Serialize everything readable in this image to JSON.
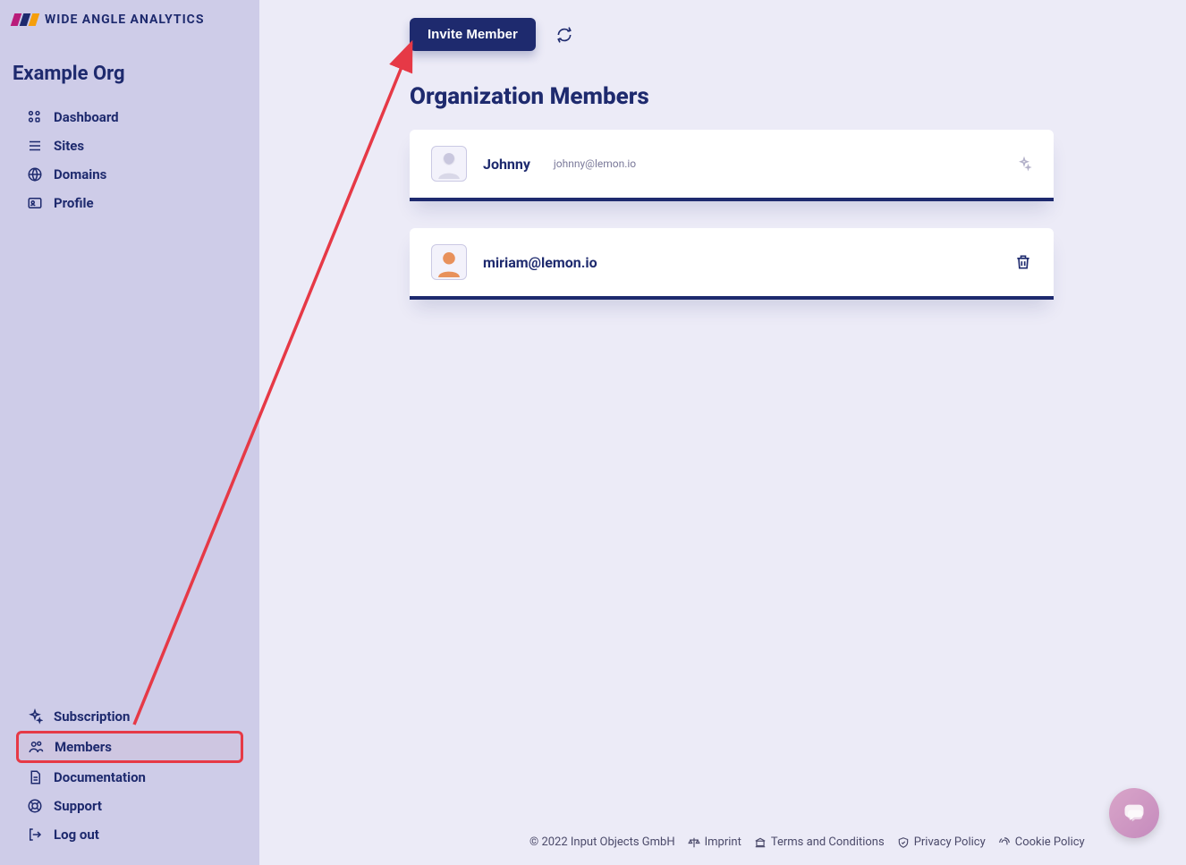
{
  "brand": {
    "name": "WIDE ANGLE ANALYTICS"
  },
  "org": {
    "name": "Example Org"
  },
  "sidebar": {
    "top": [
      {
        "label": "Dashboard"
      },
      {
        "label": "Sites"
      },
      {
        "label": "Domains"
      },
      {
        "label": "Profile"
      }
    ],
    "bottom": [
      {
        "label": "Subscription"
      },
      {
        "label": "Members"
      },
      {
        "label": "Documentation"
      },
      {
        "label": "Support"
      },
      {
        "label": "Log out"
      }
    ]
  },
  "topbar": {
    "invite_label": "Invite Member"
  },
  "page": {
    "title": "Organization Members"
  },
  "members": [
    {
      "name": "Johnny",
      "email": "johnny@lemon.io",
      "is_owner": true
    },
    {
      "name": "",
      "email": "miriam@lemon.io",
      "is_owner": false
    }
  ],
  "footer": {
    "copyright": "© 2022 Input Objects GmbH",
    "links": [
      {
        "label": "Imprint"
      },
      {
        "label": "Terms and Conditions"
      },
      {
        "label": "Privacy Policy"
      },
      {
        "label": "Cookie Policy"
      }
    ]
  }
}
